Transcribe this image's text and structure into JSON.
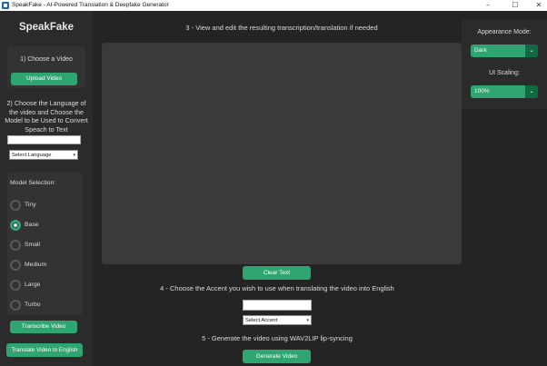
{
  "window": {
    "title": "SpeakFake - AI-Powered Translation & Deepfake Generator",
    "minimize_glyph": "–",
    "maximize_glyph": "☐",
    "close_glyph": "✕"
  },
  "sidebar": {
    "brand": "SpeakFake",
    "step1_label": "1) Choose a Video",
    "upload_button": "Upload Video",
    "step2_label": "2) Choose the Language of the video and Choose the Model to be Used to Convert Speach to Text",
    "language_input_value": "",
    "language_select": "Select Language",
    "model_title": "Model Selection:",
    "models": [
      "Tiny",
      "Base",
      "Small",
      "Medium",
      "Large",
      "Turbo"
    ],
    "selected_model": "Base",
    "transcribe_button": "Transcribe Video",
    "translate_button": "Translate Video to English"
  },
  "main": {
    "step3_label": "3 - View and edit the resulting transcription/translation if needed",
    "transcription_text": "",
    "clear_button": "Clear Text",
    "step4_label": "4 - Choose the Accent you wish to use when translating the video into English",
    "accent_input_value": "",
    "accent_select": "Select Accent",
    "step5_label": "5 - Generate the video using WAV2LIP lip-syncing",
    "generate_button": "Generate Video"
  },
  "settings": {
    "appearance_label": "Appearance Mode:",
    "appearance_value": "Dark",
    "scaling_label": "UI Scaling:",
    "scaling_value": "100%"
  },
  "icons": {
    "caret": "⌄",
    "select_caret": "▾"
  },
  "colors": {
    "accent": "#2fa572",
    "accent_dark": "#106a43",
    "background": "#242424",
    "panel": "#2b2b2b",
    "frame": "#333333"
  }
}
